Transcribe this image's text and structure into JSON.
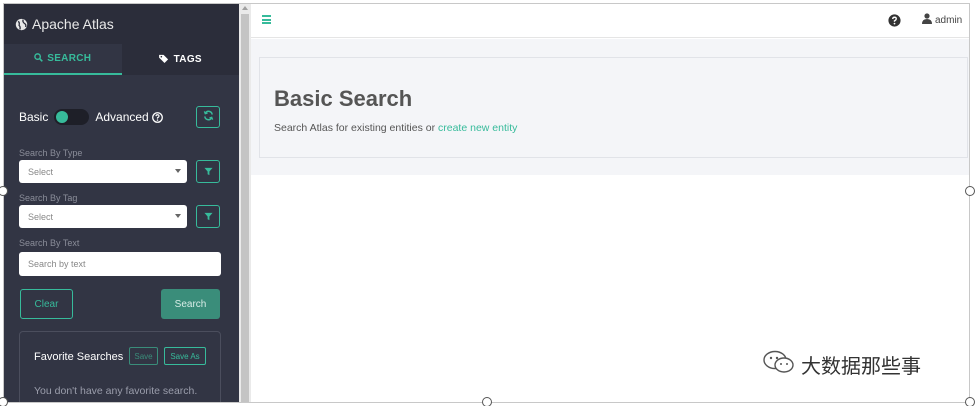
{
  "brand": {
    "title": "Apache Atlas",
    "icon": "globe-icon"
  },
  "tabs": [
    {
      "label": "SEARCH",
      "icon": "search-icon",
      "active": true
    },
    {
      "label": "TAGS",
      "icon": "tags-icon",
      "active": false
    }
  ],
  "search_mode": {
    "basic_label": "Basic",
    "advanced_label": "Advanced",
    "toggle_on": true
  },
  "by_type": {
    "label": "Search By Type",
    "placeholder": "Select"
  },
  "by_tag": {
    "label": "Search By Tag",
    "placeholder": "Select"
  },
  "by_text": {
    "label": "Search By Text",
    "placeholder": "Search by text"
  },
  "actions": {
    "clear_label": "Clear",
    "search_label": "Search"
  },
  "favorites": {
    "title": "Favorite Searches",
    "save_label": "Save",
    "save_as_label": "Save As",
    "empty_text": "You don't have any favorite search."
  },
  "header": {
    "user": "admin"
  },
  "hero": {
    "title": "Basic Search",
    "subtitle": "Search Atlas for existing entities or ",
    "link_text": "create new entity"
  },
  "watermark": {
    "text": "大数据那些事"
  },
  "colors": {
    "accent": "#37bb9b",
    "sidebar_bg": "#323544",
    "content_bg": "#f4f5f8"
  }
}
